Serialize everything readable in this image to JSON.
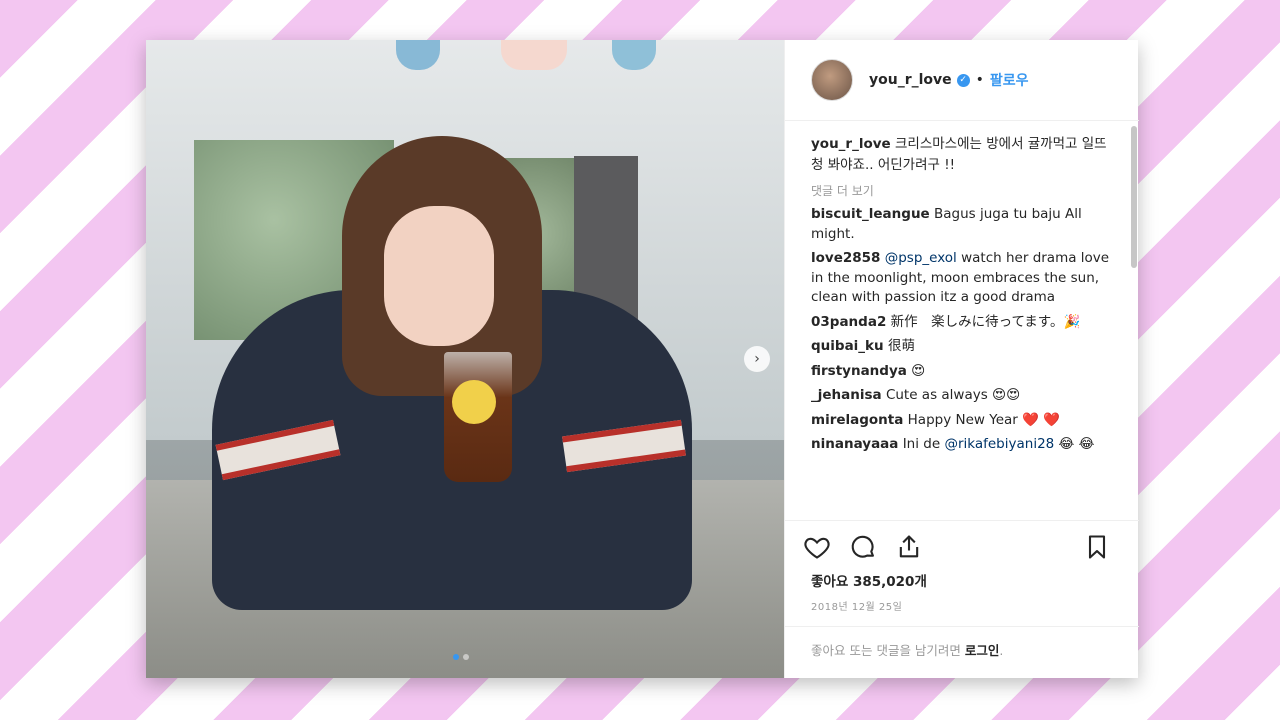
{
  "post": {
    "username": "you_r_love",
    "follow_label": "팔로우",
    "separator": "•",
    "caption": "크리스마스에는 방에서 귤까먹고 일뜨청 봐야죠.. 어딘가려구 !!",
    "view_more": "댓글 더 보기",
    "photo": {
      "next_icon": "chevron-right-icon",
      "carousel_pages": 2,
      "carousel_active": 1
    },
    "comments": [
      {
        "user": "biscuit_leangue",
        "text": "Bagus juga tu baju All might."
      },
      {
        "user": "love2858",
        "mention": "@psp_exol",
        "text": "watch her drama love in the moonlight, moon embraces the sun, clean with passion itz a good drama"
      },
      {
        "user": "03panda2",
        "text": "新作　楽しみに待ってます。🎉"
      },
      {
        "user": "quibai_ku",
        "text": "很萌"
      },
      {
        "user": "firstynandya",
        "text": "😍"
      },
      {
        "user": "_jehanisa",
        "text": "Cute as always 😍😍"
      },
      {
        "user": "mirelagonta",
        "text": "Happy New Year ❤️ ❤️"
      },
      {
        "user": "ninanayaaa",
        "text_before": "Ini de",
        "mention": "@rikafebiyani28",
        "text": "😂 😂"
      }
    ],
    "actions": {
      "like_icon": "heart-icon",
      "comment_icon": "comment-icon",
      "share_icon": "share-icon",
      "save_icon": "bookmark-icon"
    },
    "likes": "좋아요 385,020개",
    "date": "2018년 12월 25일",
    "login_prompt": "좋아요 또는 댓글을 남기려면",
    "login_link": "로그인",
    "login_suffix": "."
  },
  "colors": {
    "accent": "#3897f0",
    "stripe_pink": "#f3c6f1",
    "text": "#262626",
    "muted": "#999999"
  }
}
